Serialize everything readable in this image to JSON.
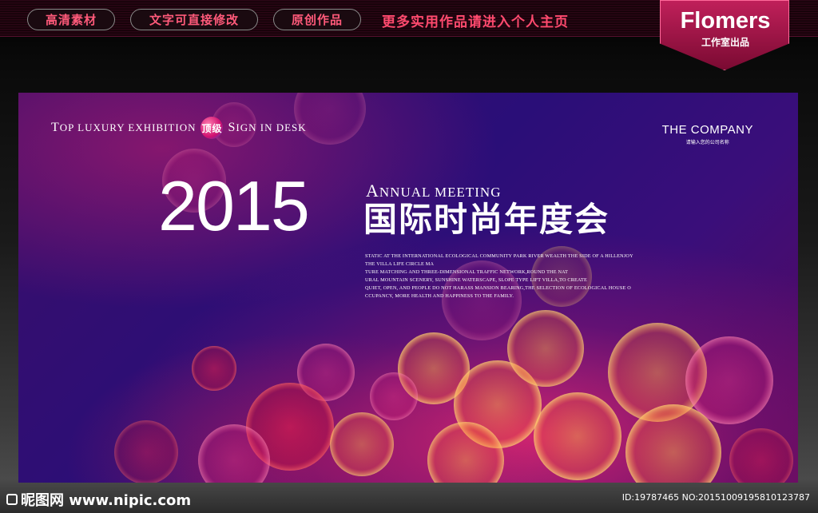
{
  "top_bar": {
    "buttons": [
      "高清素材",
      "文字可直接修改",
      "原创作品"
    ],
    "promo": "更多实用作品请进入个人主页"
  },
  "brand": {
    "name": "Flomers",
    "subtitle": "工作室出品",
    "color": "#c0205a"
  },
  "banner": {
    "tagline_part1_cap": "T",
    "tagline_part1": "OP LUXURY EXHIBITION",
    "tagline_badge": "顶级",
    "tagline_part2_cap": "S",
    "tagline_part2": "IGN IN DESK",
    "company_name": "THE COMPANY",
    "company_sub": "请输入您的公司名称",
    "year": "2015",
    "annual_cap": "A",
    "annual": "NNUAL MEETING",
    "cn_title": "国际时尚年度会",
    "body_lines": [
      "STATIC AT THE INTERNATIONAL ECOLOGICAL COMMUNITY PARK RIVER WEALTH THE SIDE OF A HILLENJOY",
      "THE VILLA LIFE CIRCLE MA",
      "TURE MATCHING AND THREE-DIMENSIONAL TRAFFIC NETWORK,ROUND THE NAT",
      "URAL MOUNTAIN SCENERY, SUNSHINE WATERSCAPE, SLOPE TYPE LIFT VILLA,TO CREATE",
      "QUIET, OPEN, AND PEOPLE DO NOT HARASS MANSION BEARING,THE SELECTION OF ECOLOGICAL HOUSE O",
      "CCUPANCY, MORE HEALTH AND HAPPINESS TO THE FAMILY."
    ]
  },
  "watermark": {
    "site": "昵图网 www.nipic.com",
    "id_text": "ID:19787465 NO:20151009195810123787"
  }
}
